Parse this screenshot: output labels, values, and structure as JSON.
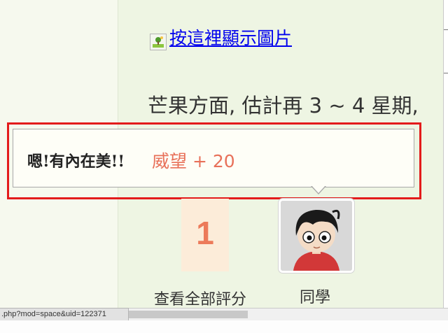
{
  "post": {
    "image_link_text": "按這裡顯示圖片",
    "body_text": "芒果方面, 估計再 3 ~ 4 星期,"
  },
  "tooltip": {
    "message": "嗯!有內在美!!",
    "reward": "威望 + 20"
  },
  "rating": {
    "count": "1",
    "view_all_label": "查看全部評分"
  },
  "user": {
    "role_label": "同學"
  },
  "status_bar": {
    "url": ".php?mod=space&uid=122371"
  },
  "colors": {
    "highlight": "#e31b1b",
    "reward": "#e8715a",
    "count": "#ec7a5a",
    "link": "#0000ee"
  }
}
